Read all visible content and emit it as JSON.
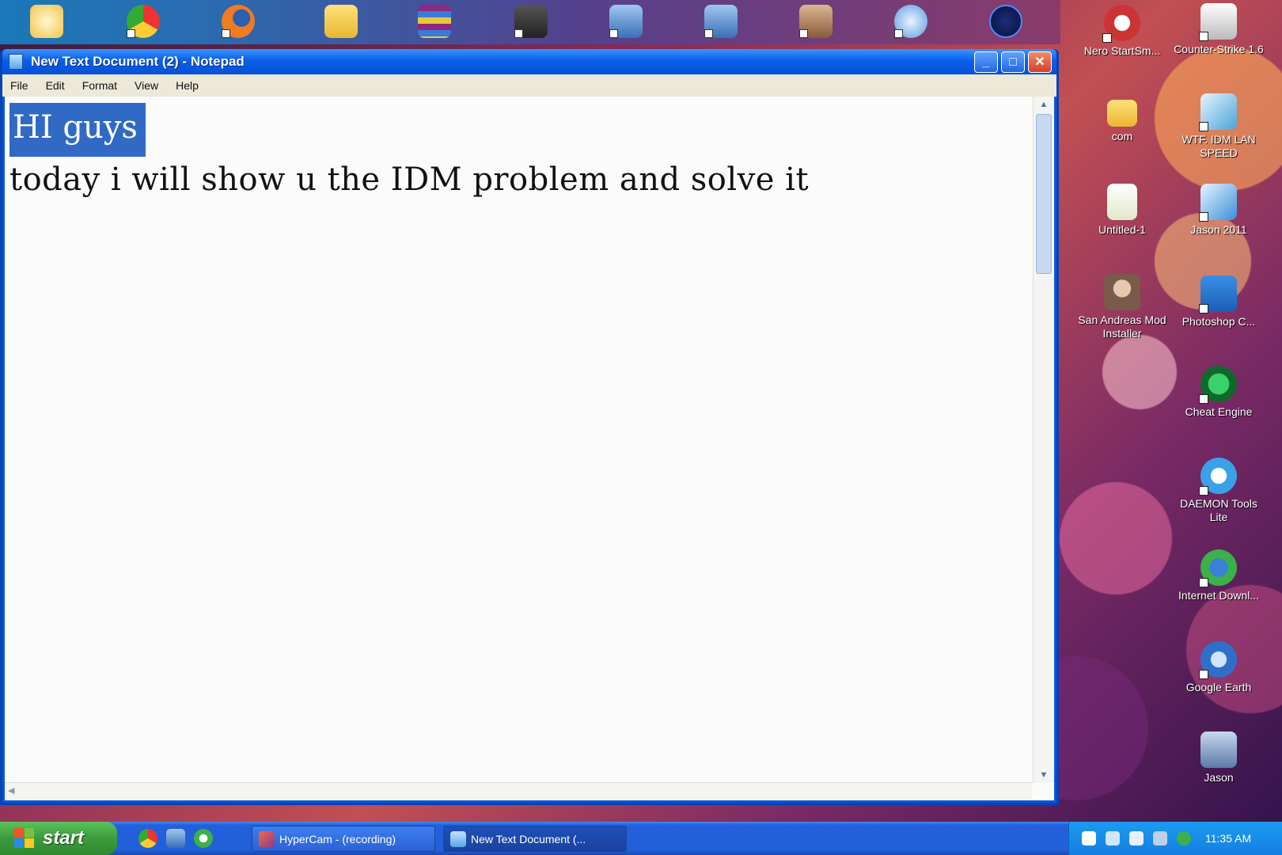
{
  "window": {
    "title": "New Text Document (2) - Notepad",
    "menu": [
      "File",
      "Edit",
      "Format",
      "View",
      "Help"
    ],
    "content_line1": "HI guys",
    "content_line2": "today i will show u the IDM  problem and solve it"
  },
  "desktop_icons": [
    {
      "label": "Nero StartSm...",
      "icon": "nero-icon",
      "color": "#c33"
    },
    {
      "label": "Counter-Strike 1.6",
      "icon": "counter-strike-icon",
      "color": "#ddd"
    },
    {
      "label": "com",
      "icon": "folder-icon",
      "color": "#f2c84b"
    },
    {
      "label": "WTF. IDM LAN SPEED",
      "icon": "idm-speed-icon",
      "color": "#4aa3d8"
    },
    {
      "label": "Untitled-1",
      "icon": "document-icon",
      "color": "#e9f0d0"
    },
    {
      "label": "Jason 2011",
      "icon": "video-icon",
      "color": "#3a8fd8"
    },
    {
      "label": "San Andreas Mod Installer",
      "icon": "person-icon",
      "color": "#b08a70"
    },
    {
      "label": "Photoshop C...",
      "icon": "photoshop-icon",
      "color": "#1f6fc4"
    },
    {
      "label": "Cheat Engine",
      "icon": "cheat-engine-icon",
      "color": "#1d9a4a"
    },
    {
      "label": "DAEMON Tools Lite",
      "icon": "daemon-tools-icon",
      "color": "#3aa0e8"
    },
    {
      "label": "Internet Downl...",
      "icon": "idm-icon",
      "color": "#3cb04a"
    },
    {
      "label": "Google Earth",
      "icon": "google-earth-icon",
      "color": "#2f6fc9"
    },
    {
      "label": "Jason",
      "icon": "photo-icon",
      "color": "#6d8bb8"
    }
  ],
  "taskbar": {
    "start_label": "start",
    "tasks": [
      "HyperCam - (recording)",
      "New Text Document (..."
    ],
    "clock": "11:35 AM"
  }
}
